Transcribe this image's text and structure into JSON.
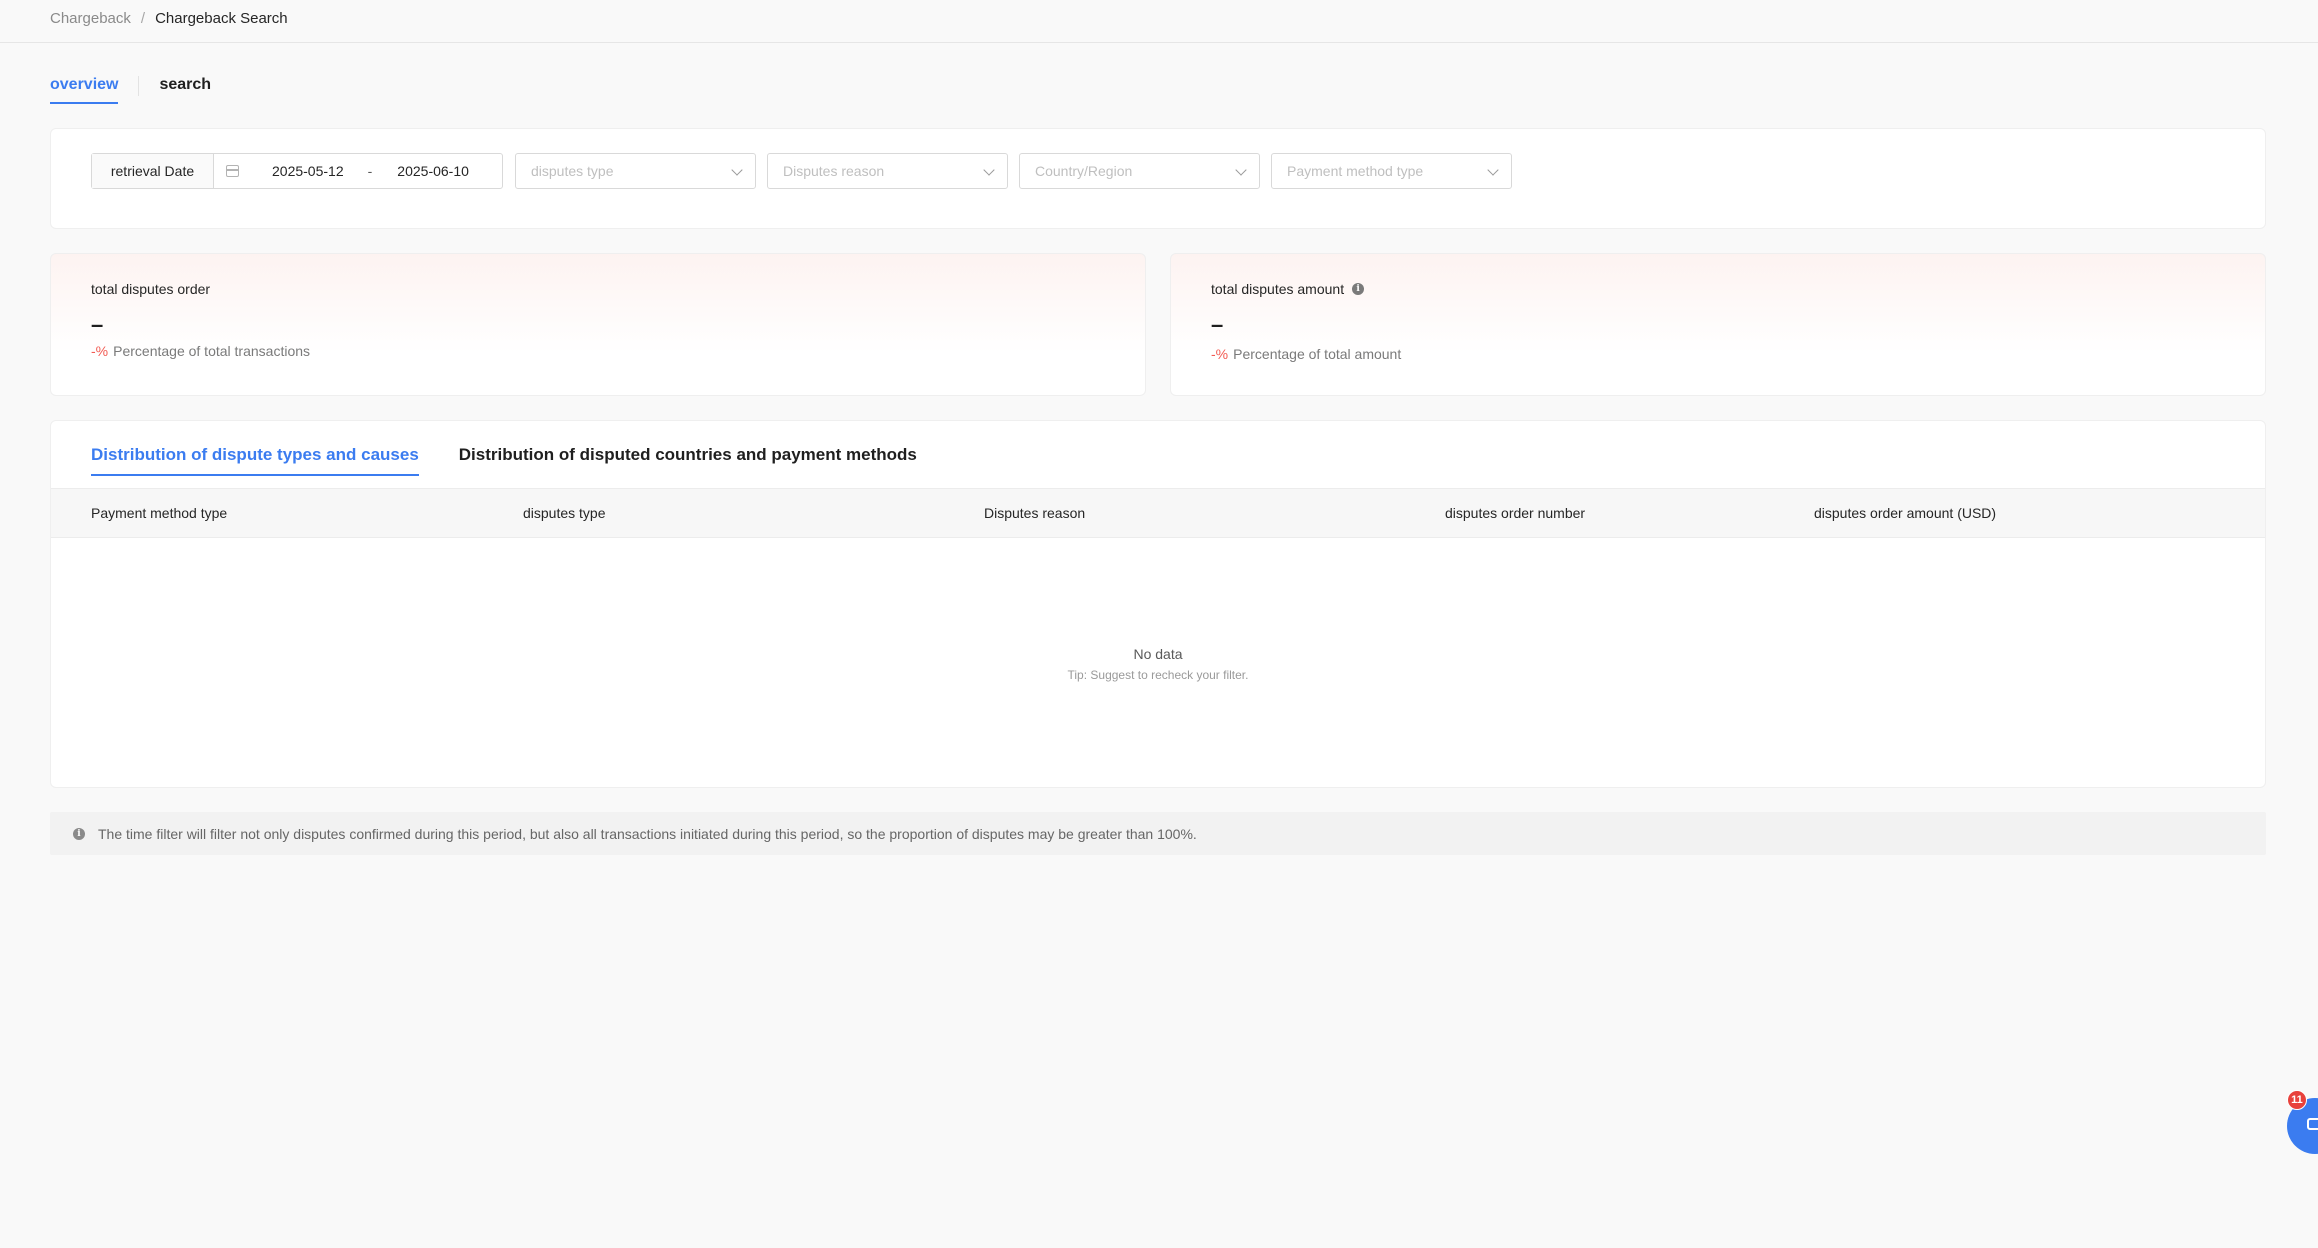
{
  "breadcrumb": {
    "parent": "Chargeback",
    "separator": "/",
    "current": "Chargeback Search"
  },
  "tabs": {
    "overview": "overview",
    "search": "search"
  },
  "filters": {
    "date_label": "retrieval Date",
    "date_start": "2025-05-12",
    "date_separator": "-",
    "date_end": "2025-06-10",
    "disputes_type_placeholder": "disputes type",
    "disputes_reason_placeholder": "Disputes reason",
    "country_placeholder": "Country/Region",
    "payment_method_placeholder": "Payment method type"
  },
  "stats": {
    "orders": {
      "title": "total disputes order",
      "value": "–",
      "pct": "-%",
      "sub": "Percentage of total transactions"
    },
    "amount": {
      "title": "total disputes amount",
      "value": "–",
      "pct": "-%",
      "sub": "Percentage of total amount"
    }
  },
  "distribution": {
    "tab_types": "Distribution of dispute types and causes",
    "tab_countries": "Distribution of disputed countries and payment methods",
    "columns": [
      "Payment method type",
      "disputes type",
      "Disputes reason",
      "disputes order number",
      "disputes order amount (USD)"
    ],
    "empty_title": "No data",
    "empty_tip": "Tip: Suggest to recheck your filter."
  },
  "notice": "The time filter will filter not only disputes confirmed during this period, but also all transactions initiated during this period, so the proportion of disputes may be greater than 100%.",
  "chat": {
    "badge": "11"
  },
  "colors": {
    "accent": "#3b7cf0",
    "danger": "#f25c54",
    "badge": "#e8413c"
  }
}
